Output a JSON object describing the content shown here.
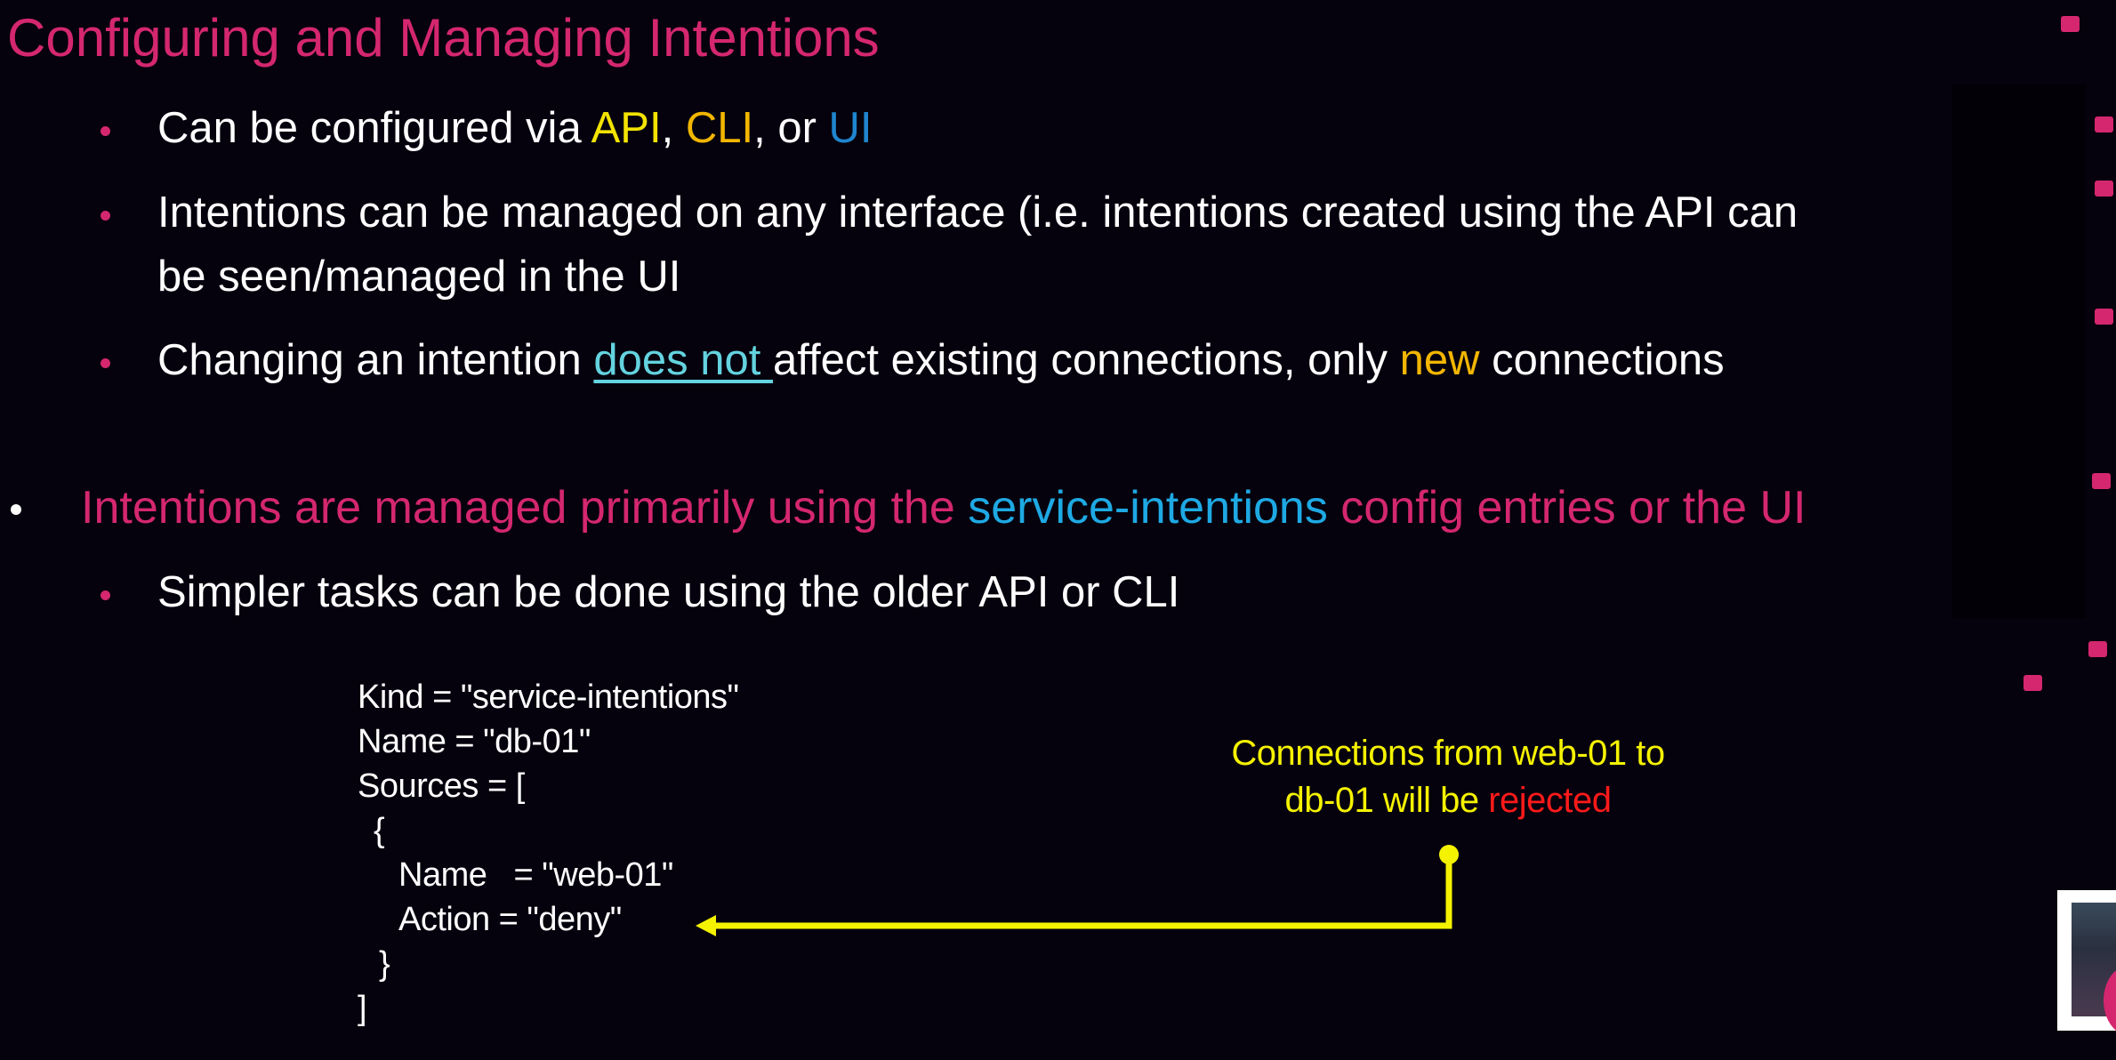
{
  "title": "Configuring and Managing Intentions",
  "bullets": {
    "b1": {
      "pre": "Can be configured via ",
      "api": "API",
      "sep1": ", ",
      "cli": "CLI",
      "sep2": ", or ",
      "ui": "UI"
    },
    "b2": {
      "line1": "Intentions can be managed on any interface (i.e. intentions created using the API can",
      "line2": "be seen/managed in the UI"
    },
    "b3": {
      "pre": "Changing an intention ",
      "emph": "does not ",
      "mid": "affect existing connections, only ",
      "new": "new",
      "post": " connections"
    },
    "b4": {
      "pre": "Intentions are managed primarily using the ",
      "svc": "service-intentions",
      "post": " config entries or the UI"
    },
    "b5": "Simpler tasks can be done using the older API or CLI"
  },
  "code_lines": [
    "Kind = \"service-intentions\"",
    "Name = \"db-01\"",
    "Sources = [",
    "  {",
    "    Name   = \"web-01\"",
    "    Action = \"deny\"",
    "  }",
    "]"
  ],
  "annotation": {
    "line1": "Connections from web-01 to",
    "line2_pre": "db-01 will be ",
    "line2_red": "rejected"
  },
  "colors": {
    "accent": "#d4276f",
    "api": "#f3e300",
    "cli": "#f2b600",
    "ui": "#1f86cf",
    "annotation": "#f5f200",
    "rejected": "#ff1a1a"
  }
}
